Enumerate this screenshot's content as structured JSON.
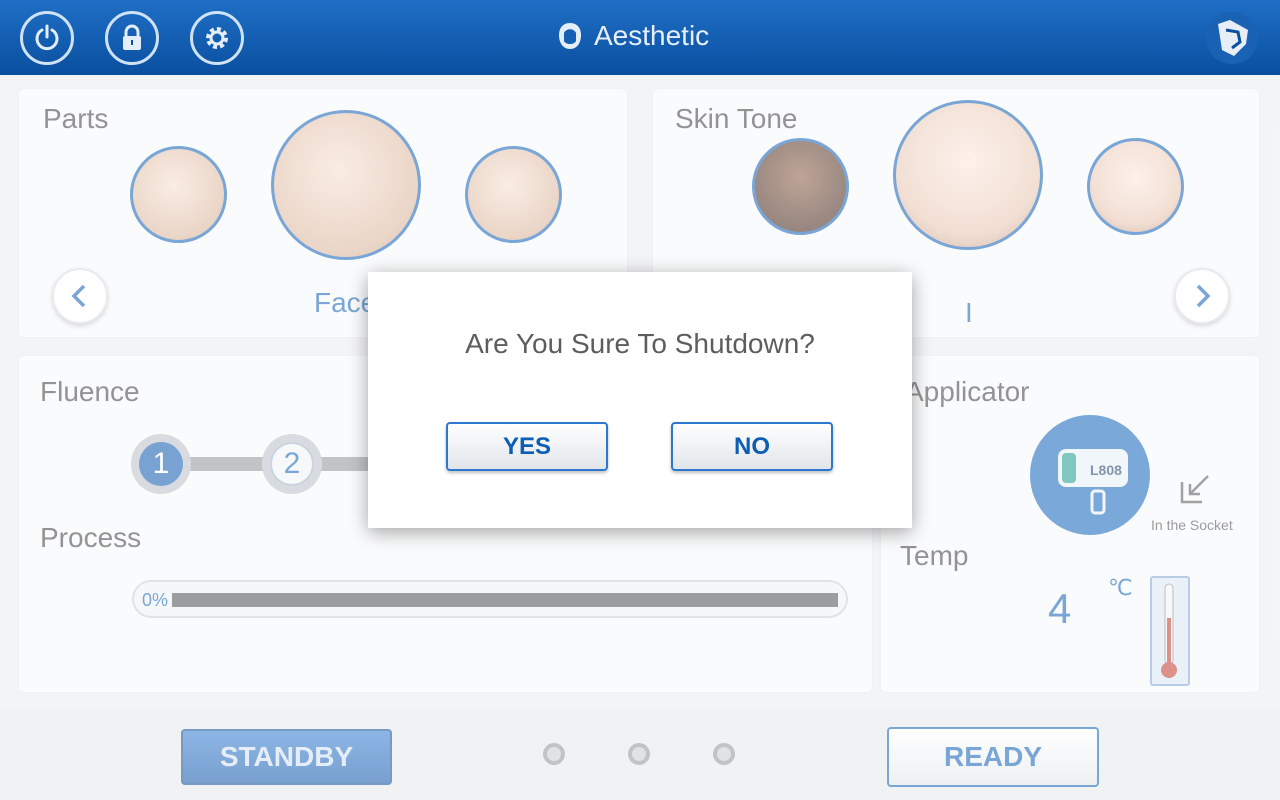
{
  "header": {
    "title": "Aesthetic",
    "buttons": [
      "power-icon",
      "lock-icon",
      "gear-icon"
    ],
    "logo": "brand-logo"
  },
  "parts": {
    "title": "Parts",
    "selected_label": "Face",
    "thumbnails": [
      "legs",
      "face",
      "abdomen"
    ]
  },
  "skin_tone": {
    "title": "Skin Tone",
    "selected_label": "I",
    "thumbnails": [
      "dark-skin",
      "medium-skin",
      "light-skin"
    ]
  },
  "fluence": {
    "title": "Fluence",
    "steps": [
      "1",
      "2"
    ]
  },
  "process": {
    "title": "Process",
    "percent_label": "0%",
    "value": 0
  },
  "applicator": {
    "title": "Applicator",
    "model": "L808",
    "status": "In the Socket"
  },
  "temp": {
    "title": "Temp",
    "value": "4",
    "unit": "℃"
  },
  "bottom": {
    "standby_label": "STANDBY",
    "ready_label": "READY",
    "indicator_count": 3
  },
  "dialog": {
    "message": "Are You Sure To Shutdown?",
    "yes_label": "YES",
    "no_label": "NO"
  },
  "colors": {
    "primary": "#0c5eb4",
    "header_top": "#1f6fc6",
    "header_bottom": "#0a4f9f"
  }
}
